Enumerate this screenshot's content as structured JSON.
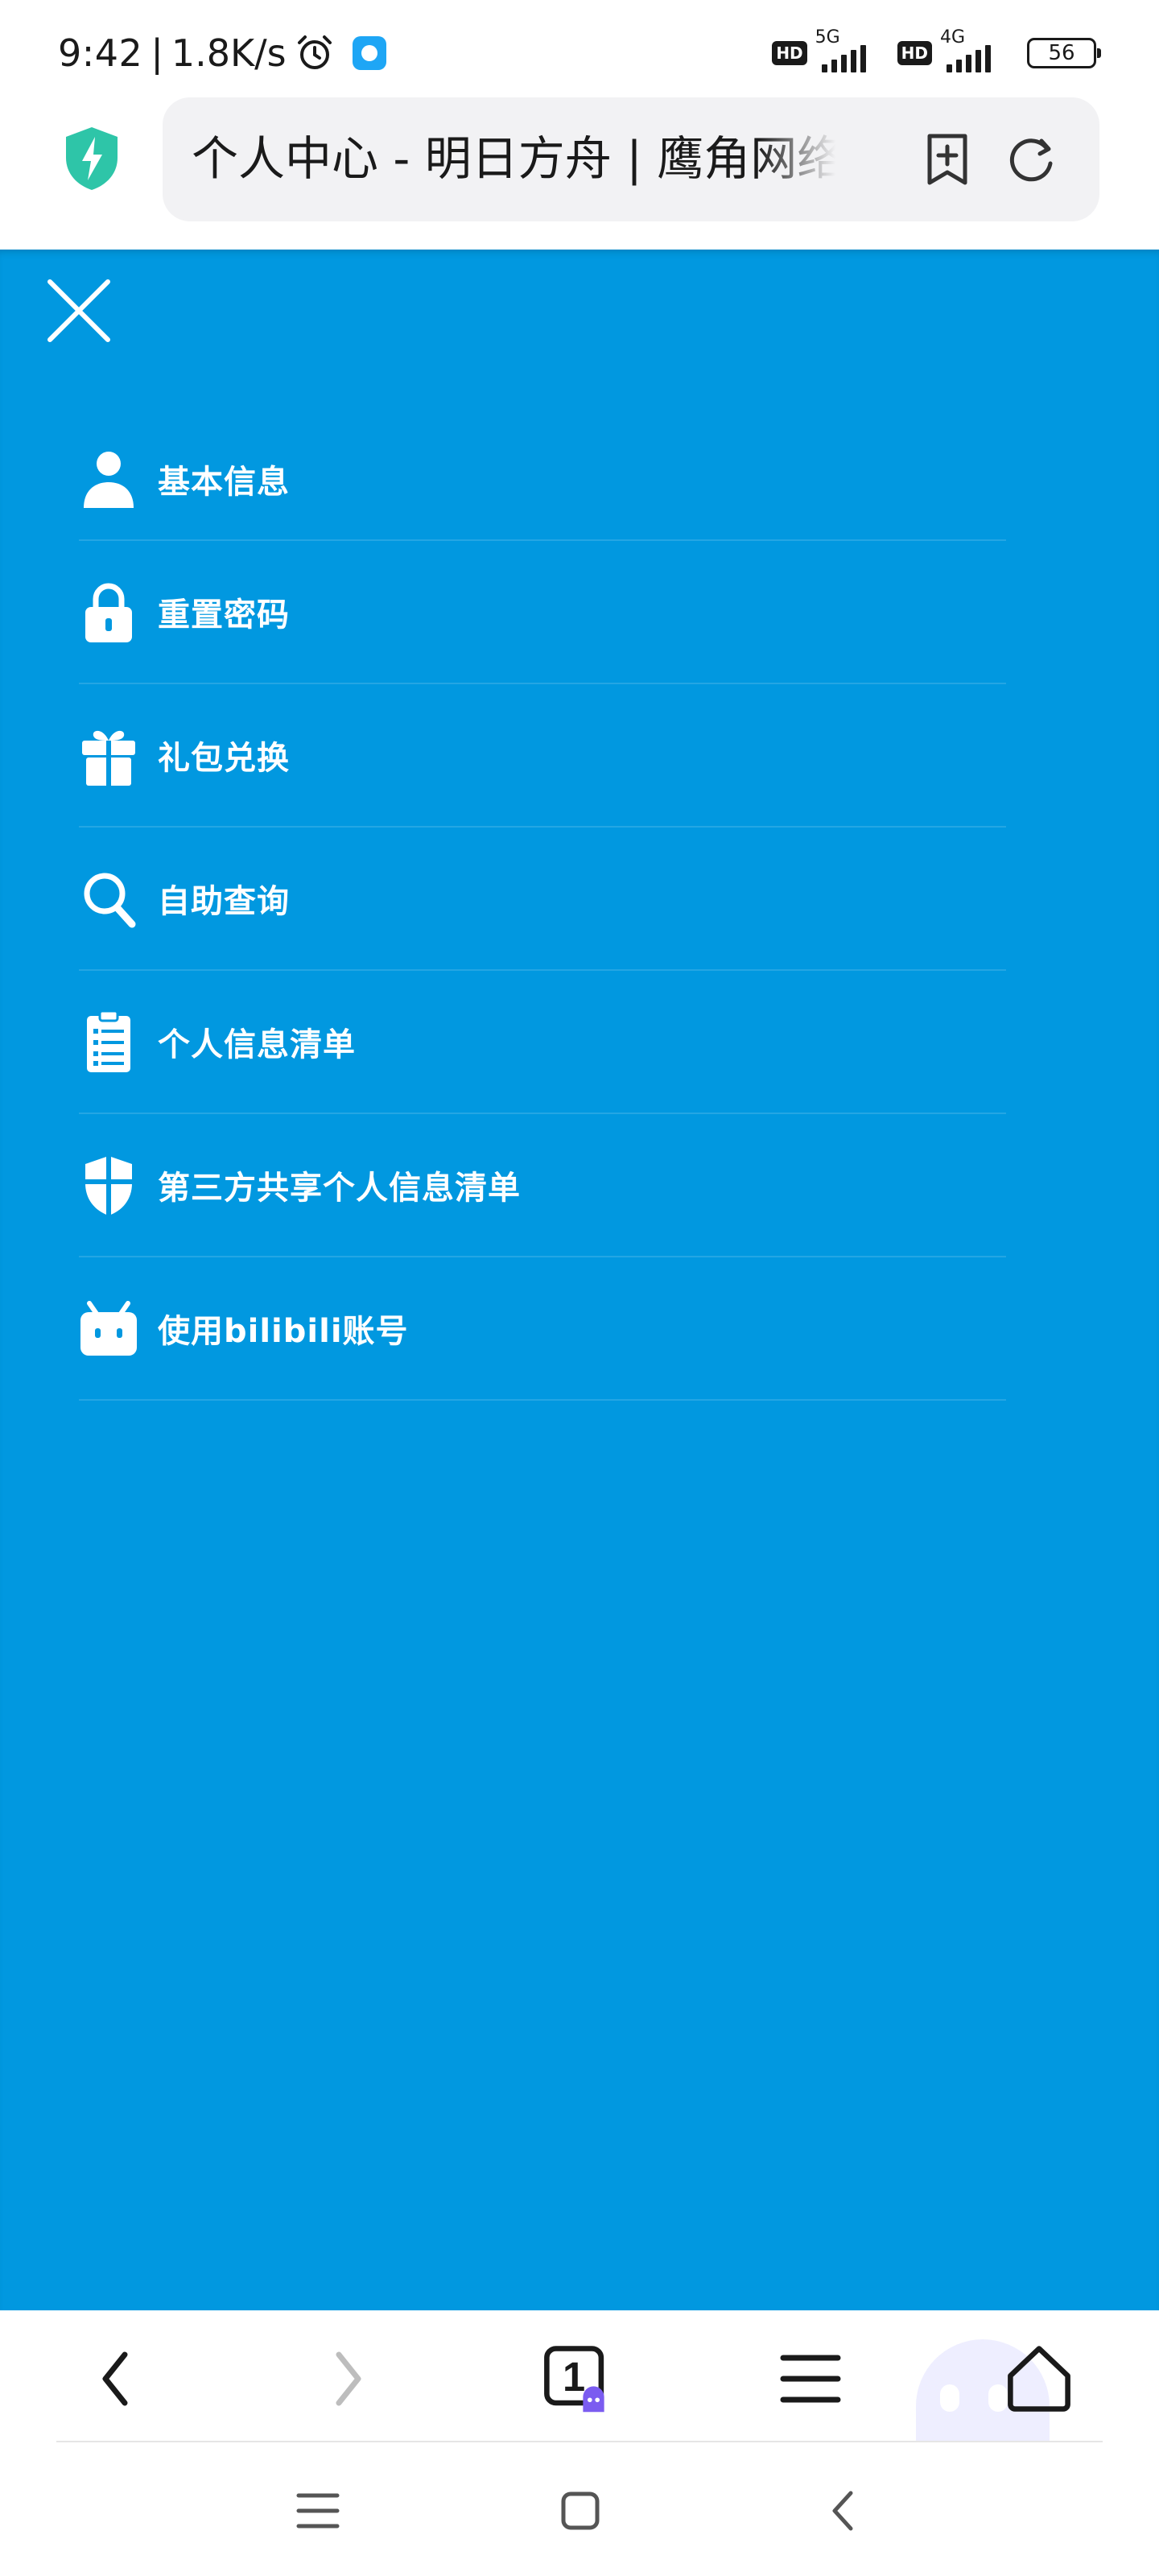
{
  "status_bar": {
    "time": "9:42",
    "separator": "|",
    "speed": "1.8K/s",
    "sim1": {
      "badge": "HD",
      "network": "5G"
    },
    "sim2": {
      "badge": "HD",
      "network": "4G"
    },
    "battery": "56"
  },
  "browser": {
    "page_title": "个人中心 - 明日方舟 | 鹰角网络",
    "tab_count": "1",
    "icons": {
      "security": "shield-bolt-icon",
      "bookmark": "bookmark-add-icon",
      "reload": "reload-icon",
      "back": "chevron-left-icon",
      "forward": "chevron-right-icon",
      "tabs": "tabs-icon",
      "menu": "hamburger-icon",
      "home": "home-icon"
    }
  },
  "menu": {
    "close_icon": "close-icon",
    "items": [
      {
        "label": "基本信息",
        "icon": "user-icon"
      },
      {
        "label": "重置密码",
        "icon": "lock-icon"
      },
      {
        "label": "礼包兑换",
        "icon": "gift-icon"
      },
      {
        "label": "自助查询",
        "icon": "search-icon"
      },
      {
        "label": "个人信息清单",
        "icon": "clipboard-list-icon"
      },
      {
        "label": "第三方共享个人信息清单",
        "icon": "shield-icon"
      },
      {
        "label": "使用bilibili账号",
        "icon": "bilibili-icon"
      }
    ]
  },
  "colors": {
    "panel_bg": "#0198e0",
    "menu_text": "#ffffff",
    "address_bg": "#f2f2f4",
    "security_shield": "#2ec5a8",
    "tab_badge": "#7b5cf0"
  },
  "system_nav": {
    "recents": "recents-icon",
    "home": "square-home-icon",
    "back": "triangle-back-icon"
  }
}
